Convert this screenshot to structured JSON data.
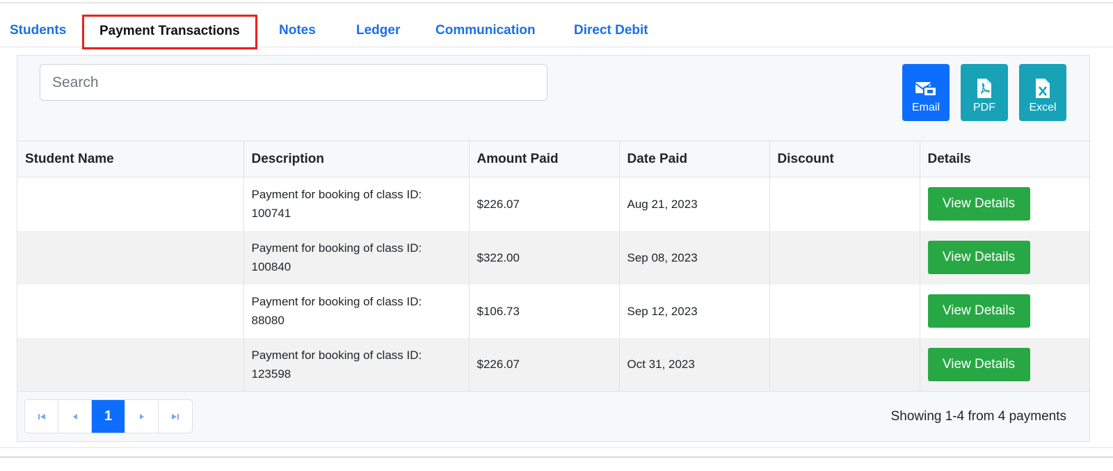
{
  "tabs": [
    {
      "label": "Students"
    },
    {
      "label": "Payment Transactions"
    },
    {
      "label": "Notes"
    },
    {
      "label": "Ledger"
    },
    {
      "label": "Communication"
    },
    {
      "label": "Direct Debit"
    }
  ],
  "active_tab": "Payment Transactions",
  "search": {
    "placeholder": "Search",
    "value": ""
  },
  "export": {
    "email_label": "Email",
    "pdf_label": "PDF",
    "excel_label": "Excel"
  },
  "table": {
    "headers": [
      "Student Name",
      "Description",
      "Amount Paid",
      "Date Paid",
      "Discount",
      "Details"
    ],
    "rows": [
      {
        "student": "",
        "description_line1": "Payment for booking of class ID:",
        "description_line2": "100741",
        "amount": "$226.07",
        "date": "Aug 21, 2023",
        "discount": "",
        "details_label": "View Details"
      },
      {
        "student": "",
        "description_line1": "Payment for booking of class ID:",
        "description_line2": "100840",
        "amount": "$322.00",
        "date": "Sep 08, 2023",
        "discount": "",
        "details_label": "View Details"
      },
      {
        "student": "",
        "description_line1": "Payment for booking of class ID:",
        "description_line2": "88080",
        "amount": "$106.73",
        "date": "Sep 12, 2023",
        "discount": "",
        "details_label": "View Details"
      },
      {
        "student": "",
        "description_line1": "Payment for booking of class ID:",
        "description_line2": "123598",
        "amount": "$226.07",
        "date": "Oct 31, 2023",
        "discount": "",
        "details_label": "View Details"
      }
    ]
  },
  "pagination": {
    "current_page": "1",
    "summary": "Showing 1-4 from 4 payments"
  },
  "colors": {
    "accent": "#0d6efd",
    "tab_link": "#1a6fe8",
    "highlight_border": "#e8231c",
    "export_secondary": "#17a2b8",
    "success": "#28a745"
  }
}
